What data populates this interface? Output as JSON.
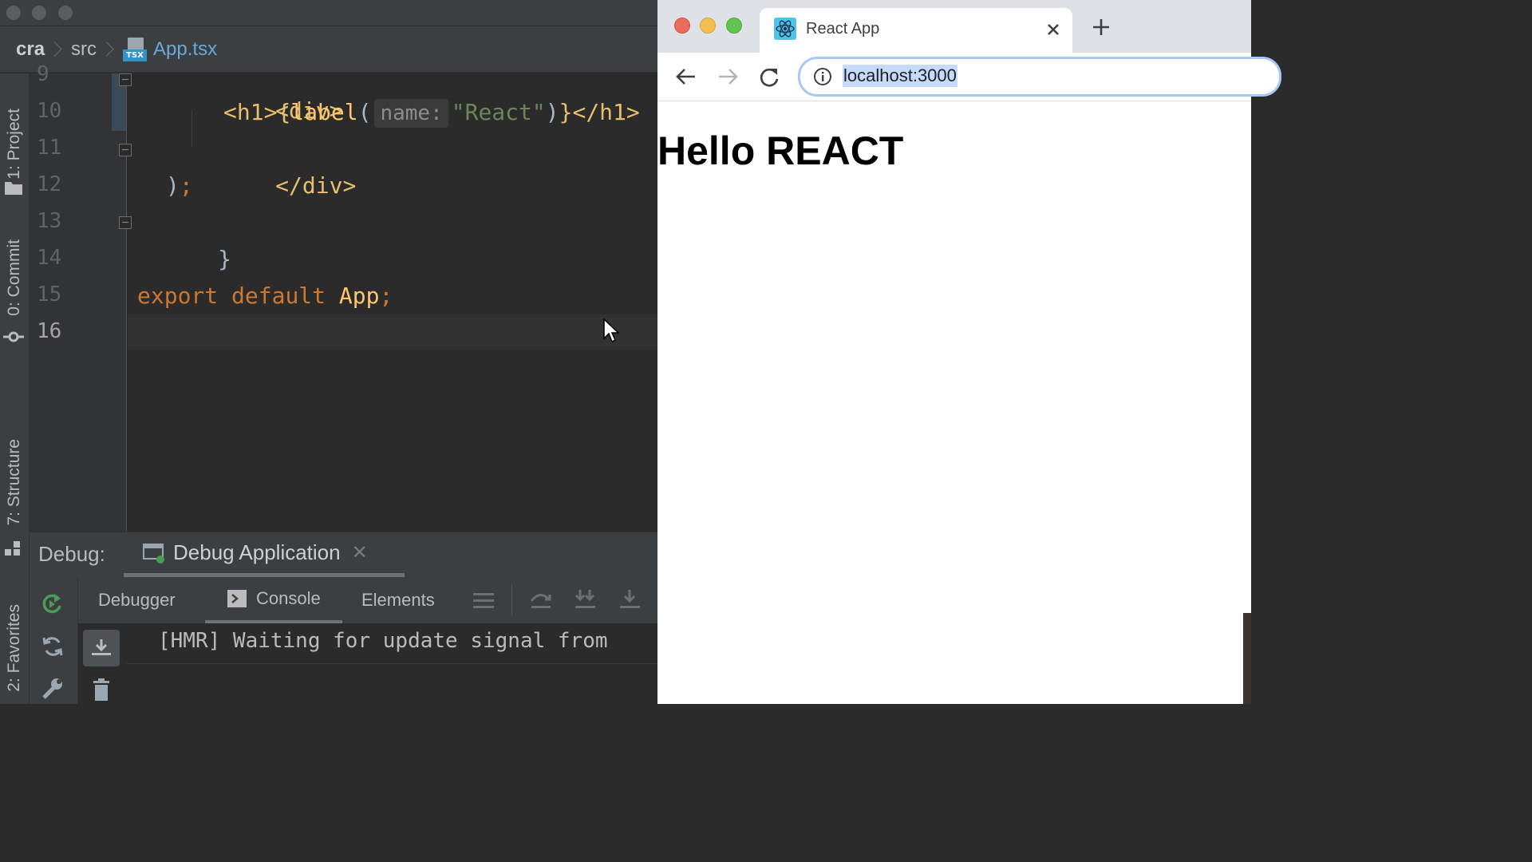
{
  "ide": {
    "breadcrumb": {
      "project": "cra",
      "folder": "src",
      "file": "App.tsx",
      "file_badge": "TSX"
    },
    "tool_windows": {
      "project": "1: Project",
      "commit": "0: Commit",
      "structure": "7: Structure",
      "favorites": "2: Favorites"
    },
    "line_numbers": [
      "9",
      "10",
      "11",
      "12",
      "13",
      "14",
      "15",
      "16"
    ],
    "code": {
      "line9": "<div>",
      "line10": {
        "open": "<h1>",
        "brace_open": "{",
        "fn": "label",
        "paren_open": "(",
        "hint": "name:",
        "arg": "\"React\"",
        "paren_close": ")",
        "brace_close": "}",
        "close": "</h1>"
      },
      "line11": "</div>",
      "line12": {
        "paren": ")",
        "semi": ";"
      },
      "line13": "}",
      "line15": {
        "kw1": "export",
        "kw2": "default",
        "ident": "App",
        "semi": ";"
      }
    },
    "debug": {
      "label": "Debug:",
      "tab": "Debug Application",
      "subtabs": [
        "Debugger",
        "Console",
        "Elements"
      ],
      "console_line": "[HMR] Waiting for update signal from"
    }
  },
  "browser": {
    "tab_title": "React App",
    "url": "localhost:3000",
    "page_heading": "Hello REACT"
  },
  "colors": {
    "ide_bg": "#2b2b2b",
    "keyword": "#cc7832",
    "string": "#6a8759",
    "tag": "#e8bf6a",
    "browser_bg": "#ffffff"
  }
}
